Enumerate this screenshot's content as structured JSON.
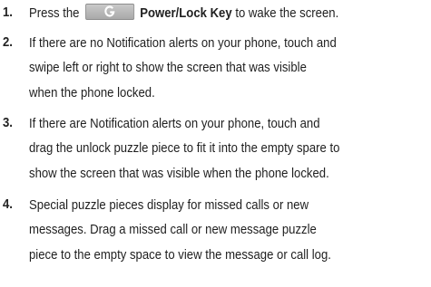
{
  "steps": [
    {
      "number": "1.",
      "before_icon": "Press the",
      "key_icon": "power-lock-key-icon",
      "bold_text": "Power/Lock Key",
      "after_bold": "to wake the screen."
    },
    {
      "number": "2.",
      "lines": [
        "If there are no Notification alerts on your phone, touch and",
        "swipe left or right to show the screen that was visible",
        "when the phone locked."
      ]
    },
    {
      "number": "3.",
      "lines": [
        "If there are Notification alerts on your phone, touch and",
        "drag the unlock puzzle piece to fit it into the empty spare to",
        "show the screen that was visible when the phone locked."
      ]
    },
    {
      "number": "4.",
      "lines": [
        "Special puzzle pieces display for missed calls or new",
        "messages. Drag a missed call or new message puzzle",
        "piece to the empty space to view the message or call log."
      ]
    }
  ]
}
